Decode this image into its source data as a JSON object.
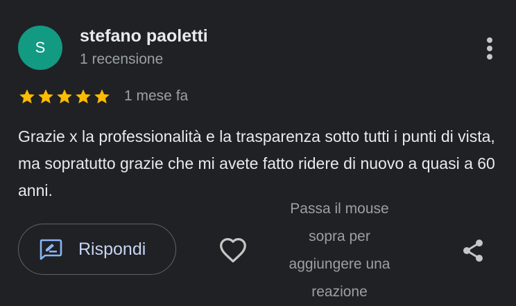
{
  "review": {
    "author": {
      "initial": "S",
      "avatar_color": "#129a83",
      "name": "stefano paoletti",
      "review_count": "1 recensione"
    },
    "rating": {
      "stars": 5,
      "max_stars": 5,
      "star_color": "#fbbc04"
    },
    "time": "1 mese fa",
    "text": "Grazie x la professionalità e la trasparenza sotto tutti i punti di vista, ma sopratutto grazie che mi avete fatto ridere di nuovo a quasi a 60 anni."
  },
  "actions": {
    "reply_label": "Rispondi",
    "reply_icon": "reply-edit-icon",
    "like_icon": "heart-outline-icon",
    "reaction_hint": "Passa il mouse sopra per aggiungere una reazione",
    "share_icon": "share-icon",
    "more_icon": "more-vertical-icon"
  },
  "colors": {
    "background": "#202124",
    "primary_text": "#e8eaed",
    "secondary_text": "#9aa0a6",
    "button_border": "#5f6368",
    "reply_accent": "#8ab4f8"
  }
}
